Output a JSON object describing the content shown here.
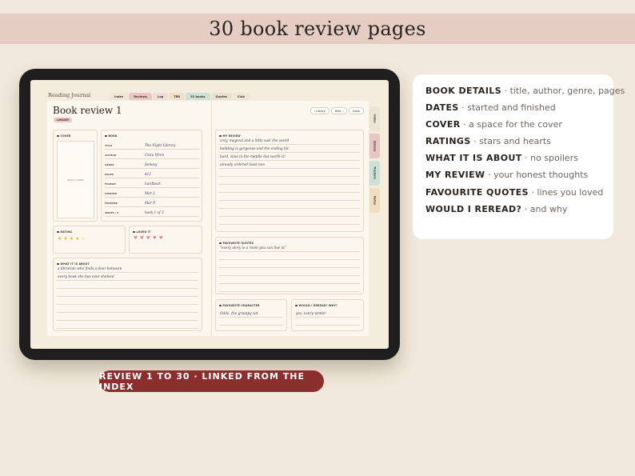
{
  "banner": {
    "title": "30 book review pages"
  },
  "journal": {
    "title": "Reading Journal",
    "top_tabs": [
      {
        "label": "Index",
        "color": "#efe6d6"
      },
      {
        "label": "Reviews",
        "color": "#e7c6c4"
      },
      {
        "label": "Log",
        "color": "#f2dcd8"
      },
      {
        "label": "TBR",
        "color": "#efe0c8"
      },
      {
        "label": "52 books",
        "color": "#cfe0d4"
      },
      {
        "label": "Quotes",
        "color": "#e9e2cd"
      },
      {
        "label": "Club",
        "color": "#efe6d6"
      }
    ],
    "side_tabs": [
      {
        "label": "Index",
        "color": "#ece4d4"
      },
      {
        "label": "Library",
        "color": "#e7c6c4"
      },
      {
        "label": "Trackers",
        "color": "#cfe0d4"
      },
      {
        "label": "Notes",
        "color": "#f0dfbf"
      }
    ],
    "page_title": "Book review 1",
    "badge": "LIBRARY",
    "nav": [
      "‹ Library",
      "Next ›",
      "Index"
    ],
    "cover": {
      "label": "COVER",
      "placeholder": "BOOK COVER"
    },
    "book": {
      "label": "BOOK",
      "fields": [
        {
          "key": "TITLE",
          "value": "The Night Library"
        },
        {
          "key": "AUTHOR",
          "value": "Clara Wren"
        },
        {
          "key": "GENRE",
          "value": "fantasy"
        },
        {
          "key": "PAGES",
          "value": "412"
        },
        {
          "key": "FORMAT",
          "value": "hardback"
        },
        {
          "key": "STARTED",
          "value": "Mar 2"
        },
        {
          "key": "FINISHED",
          "value": "Mar 9"
        },
        {
          "key": "SERIES / #",
          "value": "book 1 of 3"
        }
      ]
    },
    "rating": {
      "label": "RATING",
      "value": 4,
      "max": 5
    },
    "loved": {
      "label": "LOVED IT",
      "value": 5,
      "max": 5
    },
    "about": {
      "label": "WHAT IT IS ABOUT",
      "lines": [
        "a librarian who finds a door between",
        "every book she has ever shelved"
      ]
    },
    "review": {
      "label": "MY REVIEW",
      "lines": [
        "cozy, magical and a little sad. the world",
        "building is gorgeous and the ending hit",
        "hard. slow in the middle but worth it!",
        "already ordered book two"
      ]
    },
    "quotes": {
      "label": "FAVOURITE QUOTES",
      "lines": [
        "\"every story is a room you can live in\""
      ]
    },
    "character": {
      "label": "FAVOURITE CHARACTER",
      "value": "Odile, the grumpy cat"
    },
    "reread": {
      "label": "WOULD I REREAD? WHY?",
      "value": "yes, every winter"
    }
  },
  "info": {
    "items": [
      {
        "title": "BOOK DETAILS",
        "desc": " · title, author, genre, pages"
      },
      {
        "title": "DATES",
        "desc": " · started and finished"
      },
      {
        "title": "COVER",
        "desc": " · a space for the cover"
      },
      {
        "title": "RATINGS",
        "desc": " · stars and hearts"
      },
      {
        "title": "WHAT IT IS ABOUT",
        "desc": " · no spoilers"
      },
      {
        "title": "MY REVIEW",
        "desc": " · your honest thoughts"
      },
      {
        "title": "FAVOURITE QUOTES",
        "desc": " · lines you loved"
      },
      {
        "title": "WOULD I REREAD?",
        "desc": " · and why"
      }
    ]
  },
  "cta": {
    "label": "REVIEW 1 TO 30 · LINKED FROM THE INDEX"
  }
}
